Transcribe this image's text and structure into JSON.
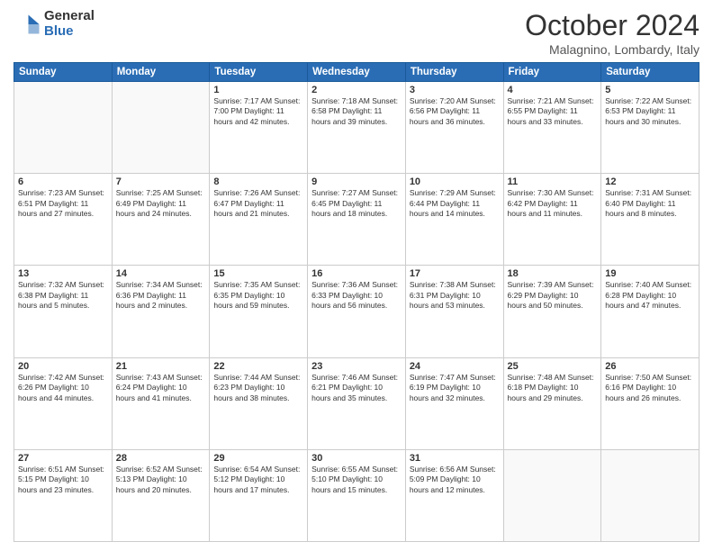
{
  "logo": {
    "general": "General",
    "blue": "Blue"
  },
  "header": {
    "month": "October 2024",
    "location": "Malagnino, Lombardy, Italy"
  },
  "weekdays": [
    "Sunday",
    "Monday",
    "Tuesday",
    "Wednesday",
    "Thursday",
    "Friday",
    "Saturday"
  ],
  "weeks": [
    [
      {
        "day": "",
        "info": ""
      },
      {
        "day": "",
        "info": ""
      },
      {
        "day": "1",
        "info": "Sunrise: 7:17 AM\nSunset: 7:00 PM\nDaylight: 11 hours and 42 minutes."
      },
      {
        "day": "2",
        "info": "Sunrise: 7:18 AM\nSunset: 6:58 PM\nDaylight: 11 hours and 39 minutes."
      },
      {
        "day": "3",
        "info": "Sunrise: 7:20 AM\nSunset: 6:56 PM\nDaylight: 11 hours and 36 minutes."
      },
      {
        "day": "4",
        "info": "Sunrise: 7:21 AM\nSunset: 6:55 PM\nDaylight: 11 hours and 33 minutes."
      },
      {
        "day": "5",
        "info": "Sunrise: 7:22 AM\nSunset: 6:53 PM\nDaylight: 11 hours and 30 minutes."
      }
    ],
    [
      {
        "day": "6",
        "info": "Sunrise: 7:23 AM\nSunset: 6:51 PM\nDaylight: 11 hours and 27 minutes."
      },
      {
        "day": "7",
        "info": "Sunrise: 7:25 AM\nSunset: 6:49 PM\nDaylight: 11 hours and 24 minutes."
      },
      {
        "day": "8",
        "info": "Sunrise: 7:26 AM\nSunset: 6:47 PM\nDaylight: 11 hours and 21 minutes."
      },
      {
        "day": "9",
        "info": "Sunrise: 7:27 AM\nSunset: 6:45 PM\nDaylight: 11 hours and 18 minutes."
      },
      {
        "day": "10",
        "info": "Sunrise: 7:29 AM\nSunset: 6:44 PM\nDaylight: 11 hours and 14 minutes."
      },
      {
        "day": "11",
        "info": "Sunrise: 7:30 AM\nSunset: 6:42 PM\nDaylight: 11 hours and 11 minutes."
      },
      {
        "day": "12",
        "info": "Sunrise: 7:31 AM\nSunset: 6:40 PM\nDaylight: 11 hours and 8 minutes."
      }
    ],
    [
      {
        "day": "13",
        "info": "Sunrise: 7:32 AM\nSunset: 6:38 PM\nDaylight: 11 hours and 5 minutes."
      },
      {
        "day": "14",
        "info": "Sunrise: 7:34 AM\nSunset: 6:36 PM\nDaylight: 11 hours and 2 minutes."
      },
      {
        "day": "15",
        "info": "Sunrise: 7:35 AM\nSunset: 6:35 PM\nDaylight: 10 hours and 59 minutes."
      },
      {
        "day": "16",
        "info": "Sunrise: 7:36 AM\nSunset: 6:33 PM\nDaylight: 10 hours and 56 minutes."
      },
      {
        "day": "17",
        "info": "Sunrise: 7:38 AM\nSunset: 6:31 PM\nDaylight: 10 hours and 53 minutes."
      },
      {
        "day": "18",
        "info": "Sunrise: 7:39 AM\nSunset: 6:29 PM\nDaylight: 10 hours and 50 minutes."
      },
      {
        "day": "19",
        "info": "Sunrise: 7:40 AM\nSunset: 6:28 PM\nDaylight: 10 hours and 47 minutes."
      }
    ],
    [
      {
        "day": "20",
        "info": "Sunrise: 7:42 AM\nSunset: 6:26 PM\nDaylight: 10 hours and 44 minutes."
      },
      {
        "day": "21",
        "info": "Sunrise: 7:43 AM\nSunset: 6:24 PM\nDaylight: 10 hours and 41 minutes."
      },
      {
        "day": "22",
        "info": "Sunrise: 7:44 AM\nSunset: 6:23 PM\nDaylight: 10 hours and 38 minutes."
      },
      {
        "day": "23",
        "info": "Sunrise: 7:46 AM\nSunset: 6:21 PM\nDaylight: 10 hours and 35 minutes."
      },
      {
        "day": "24",
        "info": "Sunrise: 7:47 AM\nSunset: 6:19 PM\nDaylight: 10 hours and 32 minutes."
      },
      {
        "day": "25",
        "info": "Sunrise: 7:48 AM\nSunset: 6:18 PM\nDaylight: 10 hours and 29 minutes."
      },
      {
        "day": "26",
        "info": "Sunrise: 7:50 AM\nSunset: 6:16 PM\nDaylight: 10 hours and 26 minutes."
      }
    ],
    [
      {
        "day": "27",
        "info": "Sunrise: 6:51 AM\nSunset: 5:15 PM\nDaylight: 10 hours and 23 minutes."
      },
      {
        "day": "28",
        "info": "Sunrise: 6:52 AM\nSunset: 5:13 PM\nDaylight: 10 hours and 20 minutes."
      },
      {
        "day": "29",
        "info": "Sunrise: 6:54 AM\nSunset: 5:12 PM\nDaylight: 10 hours and 17 minutes."
      },
      {
        "day": "30",
        "info": "Sunrise: 6:55 AM\nSunset: 5:10 PM\nDaylight: 10 hours and 15 minutes."
      },
      {
        "day": "31",
        "info": "Sunrise: 6:56 AM\nSunset: 5:09 PM\nDaylight: 10 hours and 12 minutes."
      },
      {
        "day": "",
        "info": ""
      },
      {
        "day": "",
        "info": ""
      }
    ]
  ]
}
